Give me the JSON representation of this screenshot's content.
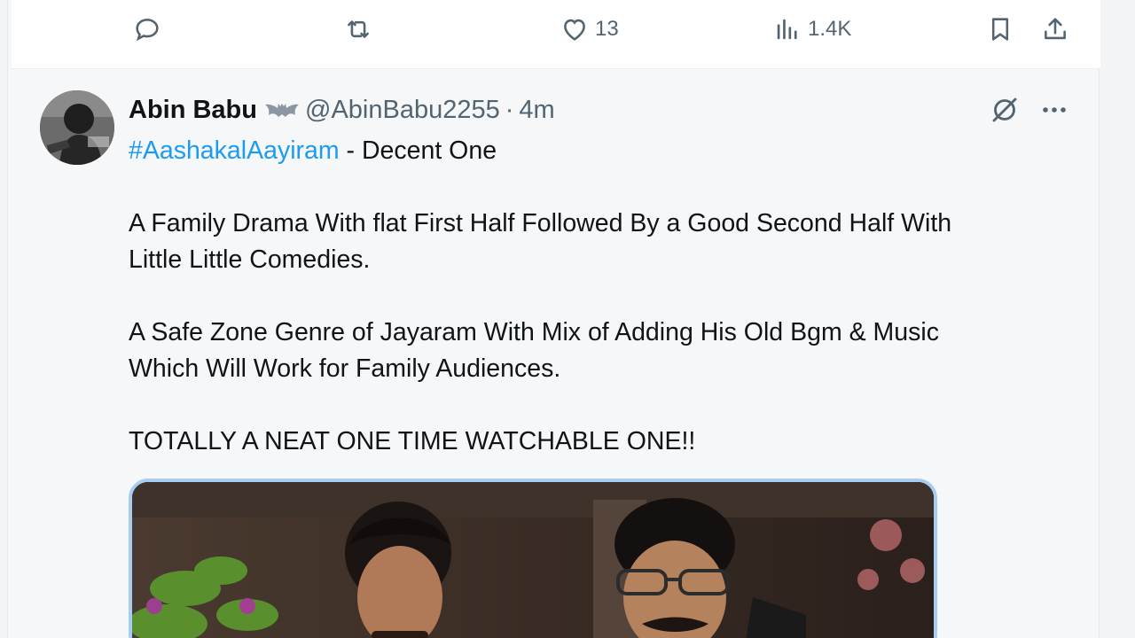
{
  "prev_tweet": {
    "actions": {
      "reply_count": "",
      "retweet_count": "",
      "like_count": "13",
      "views_count": "1.4K"
    }
  },
  "tweet": {
    "author_name": "Abin Babu",
    "handle": "@AbinBabu2255",
    "separator": "·",
    "time": "4m",
    "hashtag": "#AashakalAayiram",
    "title_suffix": " - Decent One",
    "para1_line1": "A Family Drama With flat First Half Followed By a Good Second Half With",
    "para1_line2": "Little Little Comedies.",
    "para2_line1": "A Safe Zone Genre of Jayaram With Mix of Adding His Old Bgm & Music",
    "para2_line2": "Which Will Work for Family Audiences.",
    "para3": "TOTALLY A NEAT ONE TIME WATCHABLE ONE!!"
  },
  "colors": {
    "link": "#1d9bf0",
    "muted": "#536471",
    "media_border": "#a7cdf2"
  },
  "icons": [
    "reply-icon",
    "retweet-icon",
    "like-icon",
    "views-icon",
    "bookmark-icon",
    "share-icon",
    "bat-badge-icon",
    "grok-icon",
    "more-icon"
  ]
}
